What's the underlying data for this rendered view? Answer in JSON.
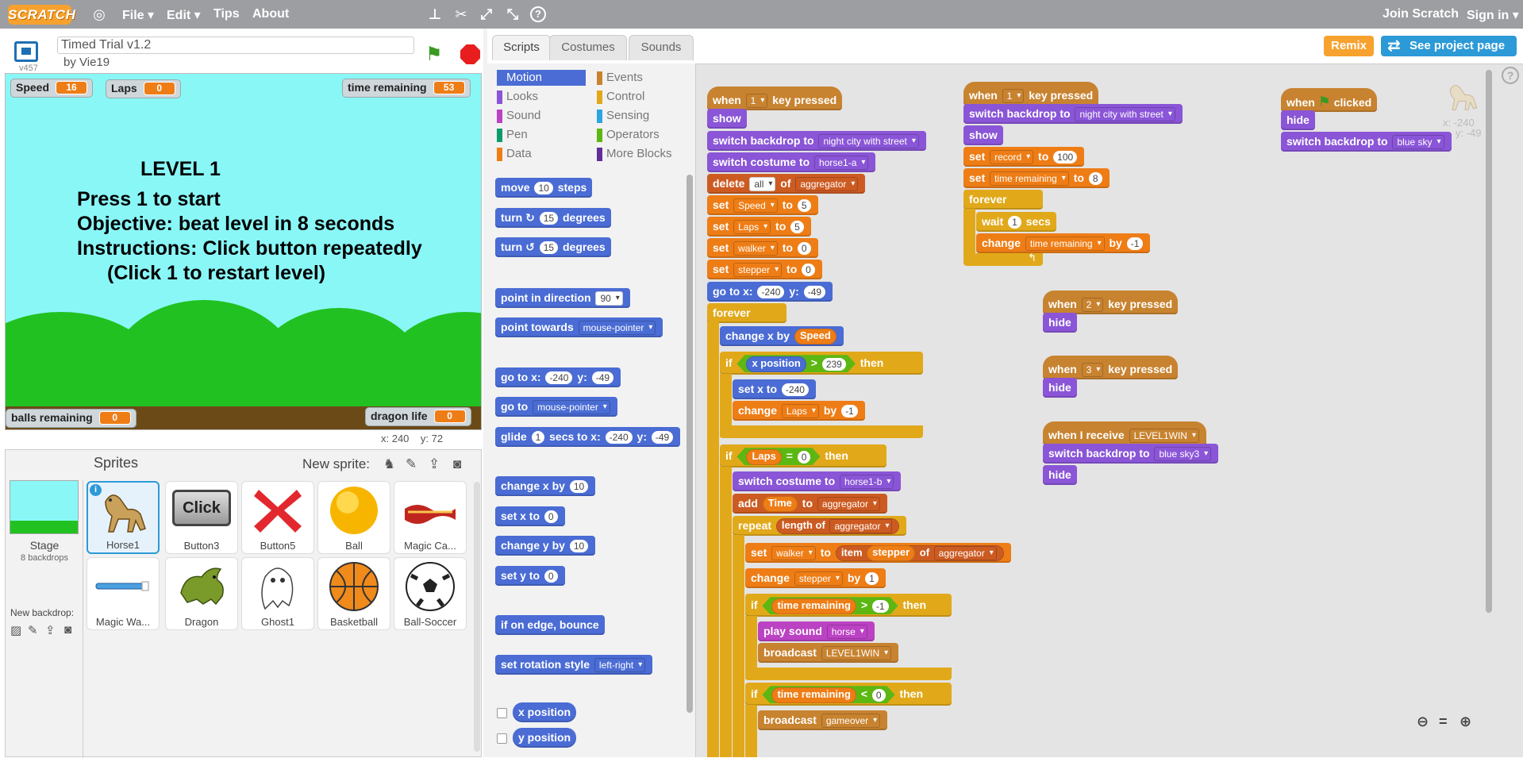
{
  "topbar": {
    "logo": "SCRATCH",
    "menu": [
      "File",
      "Edit",
      "Tips",
      "About"
    ],
    "join": "Join Scratch",
    "sign_in": "Sign in"
  },
  "project": {
    "version": "v457",
    "title": "Timed Trial v1.2",
    "byline": "by Vie19"
  },
  "stage": {
    "monitors": {
      "speed": {
        "label": "Speed",
        "value": "16"
      },
      "laps": {
        "label": "Laps",
        "value": "0"
      },
      "time_remaining": {
        "label": "time remaining",
        "value": "53"
      },
      "balls_remaining": {
        "label": "balls remaining",
        "value": "0"
      },
      "dragon_life": {
        "label": "dragon life",
        "value": "0"
      }
    },
    "text": {
      "level": "LEVEL 1",
      "line1": "Press 1 to start",
      "line2": "Objective: beat level in 8 seconds",
      "line3": "Instructions: Click button repeatedly",
      "line4": "(Click 1 to restart level)"
    },
    "mouse_x": "x: 240",
    "mouse_y": "y: 72"
  },
  "sprites_pane": {
    "header": "Sprites",
    "new_sprite": "New sprite:",
    "stage_label": "Stage",
    "backdrops_count": "8 backdrops",
    "new_backdrop": "New backdrop:",
    "sprites": [
      {
        "name": "Horse1",
        "icon": "horse-icon",
        "selected": true
      },
      {
        "name": "Button3",
        "icon": "click-button-icon",
        "selected": false
      },
      {
        "name": "Button5",
        "icon": "red-x-icon",
        "selected": false
      },
      {
        "name": "Ball",
        "icon": "yellow-ball-icon",
        "selected": false
      },
      {
        "name": "Magic Ca...",
        "icon": "magic-carpet-icon",
        "selected": false
      },
      {
        "name": "Magic Wa...",
        "icon": "magic-wand-icon",
        "selected": false
      },
      {
        "name": "Dragon",
        "icon": "dragon-icon",
        "selected": false
      },
      {
        "name": "Ghost1",
        "icon": "ghost-icon",
        "selected": false
      },
      {
        "name": "Basketball",
        "icon": "basketball-icon",
        "selected": false
      },
      {
        "name": "Ball-Soccer",
        "icon": "soccer-ball-icon",
        "selected": false
      }
    ],
    "button3_text": "Click"
  },
  "editor": {
    "tabs": [
      "Scripts",
      "Costumes",
      "Sounds"
    ],
    "remix": "Remix",
    "see_project": "See project page",
    "categories_left": [
      "Motion",
      "Looks",
      "Sound",
      "Pen",
      "Data"
    ],
    "categories_right": [
      "Events",
      "Control",
      "Sensing",
      "Operators",
      "More Blocks"
    ],
    "sprite_x": "x: -240",
    "sprite_y": "y: -49"
  },
  "palette_blocks": {
    "move": {
      "a": "move",
      "v": "10",
      "b": "steps"
    },
    "turn_cw": {
      "a": "turn",
      "v": "15",
      "b": "degrees"
    },
    "turn_ccw": {
      "a": "turn",
      "v": "15",
      "b": "degrees"
    },
    "point_dir": {
      "a": "point in direction",
      "v": "90"
    },
    "point_towards": {
      "a": "point towards",
      "v": "mouse-pointer"
    },
    "goto_xy": {
      "a": "go to x:",
      "x": "-240",
      "b": "y:",
      "y": "-49"
    },
    "goto": {
      "a": "go to",
      "v": "mouse-pointer"
    },
    "glide": {
      "a": "glide",
      "s": "1",
      "b": "secs to x:",
      "x": "-240",
      "c": "y:",
      "y": "-49"
    },
    "change_x": {
      "a": "change x by",
      "v": "10"
    },
    "set_x": {
      "a": "set x to",
      "v": "0"
    },
    "change_y": {
      "a": "change y by",
      "v": "10"
    },
    "set_y": {
      "a": "set y to",
      "v": "0"
    },
    "bounce": {
      "a": "if on edge, bounce"
    },
    "rotation": {
      "a": "set rotation style",
      "v": "left-right"
    },
    "xpos": {
      "a": "x position"
    },
    "ypos": {
      "a": "y position"
    }
  },
  "script1": {
    "hat": {
      "a": "when",
      "k": "1",
      "b": "key pressed"
    },
    "show": "show",
    "backdrop": {
      "a": "switch backdrop to",
      "v": "night city with street"
    },
    "costume": {
      "a": "switch costume to",
      "v": "horse1-a"
    },
    "delete": {
      "a": "delete",
      "v": "all",
      "b": "of",
      "l": "aggregator"
    },
    "set_speed": {
      "a": "set",
      "var": "Speed",
      "b": "to",
      "v": "5"
    },
    "set_laps": {
      "a": "set",
      "var": "Laps",
      "b": "to",
      "v": "5"
    },
    "set_walker": {
      "a": "set",
      "var": "walker",
      "b": "to",
      "v": "0"
    },
    "set_stepper": {
      "a": "set",
      "var": "stepper",
      "b": "to",
      "v": "0"
    },
    "goto": {
      "a": "go to x:",
      "x": "-240",
      "b": "y:",
      "y": "-49"
    },
    "forever": "forever",
    "change_x": {
      "a": "change x by",
      "v": "Speed"
    },
    "if1": {
      "a": "if",
      "r": "x position",
      "op": ">",
      "v": "239",
      "b": "then"
    },
    "set_x": {
      "a": "set x to",
      "v": "-240"
    },
    "change_laps": {
      "a": "change",
      "var": "Laps",
      "b": "by",
      "v": "-1"
    },
    "if2": {
      "a": "if",
      "r": "Laps",
      "op": "=",
      "v": "0",
      "b": "then"
    },
    "costume2": {
      "a": "switch costume to",
      "v": "horse1-b"
    },
    "add": {
      "a": "add",
      "r": "Time",
      "b": "to",
      "l": "aggregator"
    },
    "repeat": {
      "a": "repeat",
      "r": "length of",
      "l": "aggregator"
    },
    "set_walker2": {
      "a": "set",
      "var": "walker",
      "b": "to",
      "r": "item",
      "r2": "stepper",
      "c": "of",
      "l": "aggregator"
    },
    "change_stepper": {
      "a": "change",
      "var": "stepper",
      "b": "by",
      "v": "1"
    },
    "if3": {
      "a": "if",
      "r": "time remaining",
      "op": ">",
      "v": "-1",
      "b": "then"
    },
    "play": {
      "a": "play sound",
      "v": "horse"
    },
    "broadcast1": {
      "a": "broadcast",
      "v": "LEVEL1WIN"
    },
    "if4": {
      "a": "if",
      "r": "time remaining",
      "op": "<",
      "v": "0",
      "b": "then"
    },
    "broadcast2": {
      "a": "broadcast",
      "v": "gameover"
    }
  },
  "script2": {
    "hat": {
      "a": "when",
      "k": "1",
      "b": "key pressed"
    },
    "backdrop": {
      "a": "switch backdrop to",
      "v": "night city with street"
    },
    "show": "show",
    "set_record": {
      "a": "set",
      "var": "record",
      "b": "to",
      "v": "100"
    },
    "set_time": {
      "a": "set",
      "var": "time remaining",
      "b": "to",
      "v": "8"
    },
    "forever": "forever",
    "wait": {
      "a": "wait",
      "v": "1",
      "b": "secs"
    },
    "change_time": {
      "a": "change",
      "var": "time remaining",
      "b": "by",
      "v": "-1"
    }
  },
  "script3": {
    "hat": {
      "a": "when",
      "k": "2",
      "b": "key pressed"
    },
    "hide": "hide"
  },
  "script4": {
    "hat": {
      "a": "when",
      "k": "3",
      "b": "key pressed"
    },
    "hide": "hide"
  },
  "script5": {
    "hat": {
      "a": "when I receive",
      "v": "LEVEL1WIN"
    },
    "backdrop": {
      "a": "switch backdrop to",
      "v": "blue sky3"
    },
    "hide": "hide"
  },
  "script6": {
    "hat": {
      "a": "when",
      "b": "clicked"
    },
    "hide": "hide",
    "backdrop": {
      "a": "switch backdrop to",
      "v": "blue sky"
    }
  },
  "colors": {
    "motion": "#4a6cd4",
    "looks": "#8a55d7",
    "sound": "#bb42c3",
    "pen": "#0e9a6c",
    "data": "#ee7d16",
    "events": "#c88330",
    "control": "#e1a91a",
    "sensing": "#2ca5e2",
    "operators": "#5cb712",
    "more_blocks": "#632d99"
  }
}
